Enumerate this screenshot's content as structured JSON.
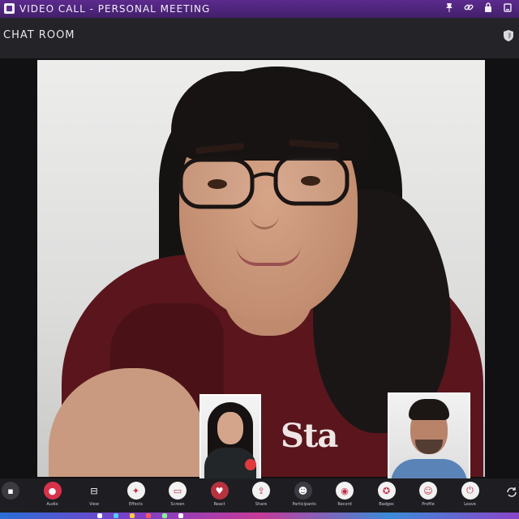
{
  "window": {
    "title": "VIDEO CALL - PERSONAL MEETING",
    "title_icons": [
      "pin-icon",
      "link-icon",
      "lock-icon",
      "minimize-icon"
    ]
  },
  "header": {
    "meeting_name": "CHAT ROOM"
  },
  "stage": {
    "shirt_text": "Sta"
  },
  "toolbar": {
    "items": [
      {
        "name": "chat-toggle",
        "icon": "chat-icon",
        "label": "",
        "color": "#3a3a40"
      },
      {
        "name": "audio",
        "icon": "mic-icon",
        "label": "Audio",
        "color": "#d8324a"
      },
      {
        "name": "view",
        "icon": "grid-icon",
        "label": "View",
        "color": "transparent"
      },
      {
        "name": "effects",
        "icon": "sparkle-icon",
        "label": "Effects",
        "color": "#f2f2f2"
      },
      {
        "name": "screen",
        "icon": "screen-icon",
        "label": "Screen",
        "color": "#f2f2f2"
      },
      {
        "name": "react",
        "icon": "heart-icon",
        "label": "React",
        "color": "#b8323f"
      },
      {
        "name": "share",
        "icon": "share-icon",
        "label": "Share",
        "color": "#f2f2f2"
      },
      {
        "name": "participants",
        "icon": "people-icon",
        "label": "Participants",
        "color": "#3b3b44"
      },
      {
        "name": "record",
        "icon": "record-icon",
        "label": "Record",
        "color": "#f2f2f2"
      },
      {
        "name": "badges",
        "icon": "badge-icon",
        "label": "Badges",
        "color": "#f2f2f2"
      },
      {
        "name": "profile",
        "icon": "avatar-icon",
        "label": "Profile",
        "color": "#f2f2f2"
      },
      {
        "name": "leave",
        "icon": "leave-icon",
        "label": "Leave",
        "color": "#f2f2f2"
      }
    ],
    "end_label": ""
  }
}
